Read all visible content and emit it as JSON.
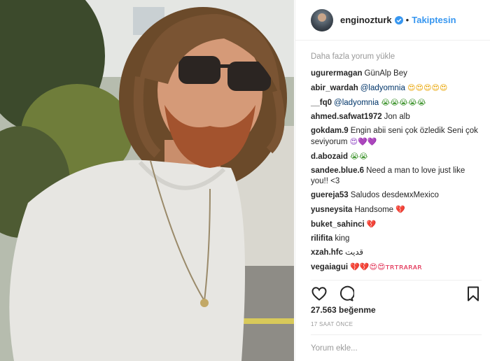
{
  "post": {
    "username": "enginozturk",
    "follow_label": "Takiptesin",
    "separator": "•",
    "load_more": "Daha fazla yorum yükle",
    "likes": "27.563 beğenme",
    "timestamp": "17 SAAT ÖNCE",
    "comment_placeholder": "Yorum ekle..."
  },
  "comments": [
    {
      "user": "ugurermagan",
      "mention": "",
      "text": "GünAlp Bey",
      "emoji": "",
      "emoji_class": ""
    },
    {
      "user": "abir_wardah",
      "mention": "@ladyomnia",
      "text": "",
      "emoji": "😍😍😍😍😍",
      "emoji_class": "e-yellow"
    },
    {
      "user": "__fq0",
      "mention": "@ladyomnia",
      "text": "",
      "emoji": "😭😭😭😭😭",
      "emoji_class": "e-green"
    },
    {
      "user": "ahmed.safwat1972",
      "mention": "",
      "text": "Jon alb",
      "emoji": "",
      "emoji_class": ""
    },
    {
      "user": "gokdam.9",
      "mention": "",
      "text": "Engin abii seni çok özledik Seni çok seviyorum",
      "emoji": "😍💜💜",
      "emoji_class": "e-purple"
    },
    {
      "user": "d.abozaid",
      "mention": "",
      "text": "",
      "emoji": "😭😭",
      "emoji_class": "e-green"
    },
    {
      "user": "sandee.blue.6",
      "mention": "",
      "text": "Need a man to love just like you!! <3",
      "emoji": "",
      "emoji_class": ""
    },
    {
      "user": "guereja53",
      "mention": "",
      "text": "Saludos desdeмxMexico",
      "emoji": "",
      "emoji_class": ""
    },
    {
      "user": "yusneysita",
      "mention": "",
      "text": "Handsome",
      "emoji": "💔",
      "emoji_class": "e-red"
    },
    {
      "user": "buket_sahinci",
      "mention": "",
      "text": "",
      "emoji": "💔",
      "emoji_class": "e-red"
    },
    {
      "user": "rilifita",
      "mention": "",
      "text": "king",
      "emoji": "",
      "emoji_class": ""
    },
    {
      "user": "xzah.hfc",
      "mention": "",
      "text": "قديت",
      "emoji": "",
      "emoji_class": ""
    },
    {
      "user": "vegaiagui",
      "mention": "",
      "text": "",
      "emoji": "💔💔😍😍ᴛʀᴛʀᴀʀᴀʀ",
      "emoji_class": "e-red"
    }
  ],
  "icons": {
    "verified": "verified-badge-icon",
    "like": "heart-icon",
    "comment": "comment-bubble-icon",
    "save": "bookmark-icon"
  },
  "colors": {
    "accent": "#3897f0",
    "text": "#262626",
    "muted": "#999999",
    "border": "#efefef"
  }
}
